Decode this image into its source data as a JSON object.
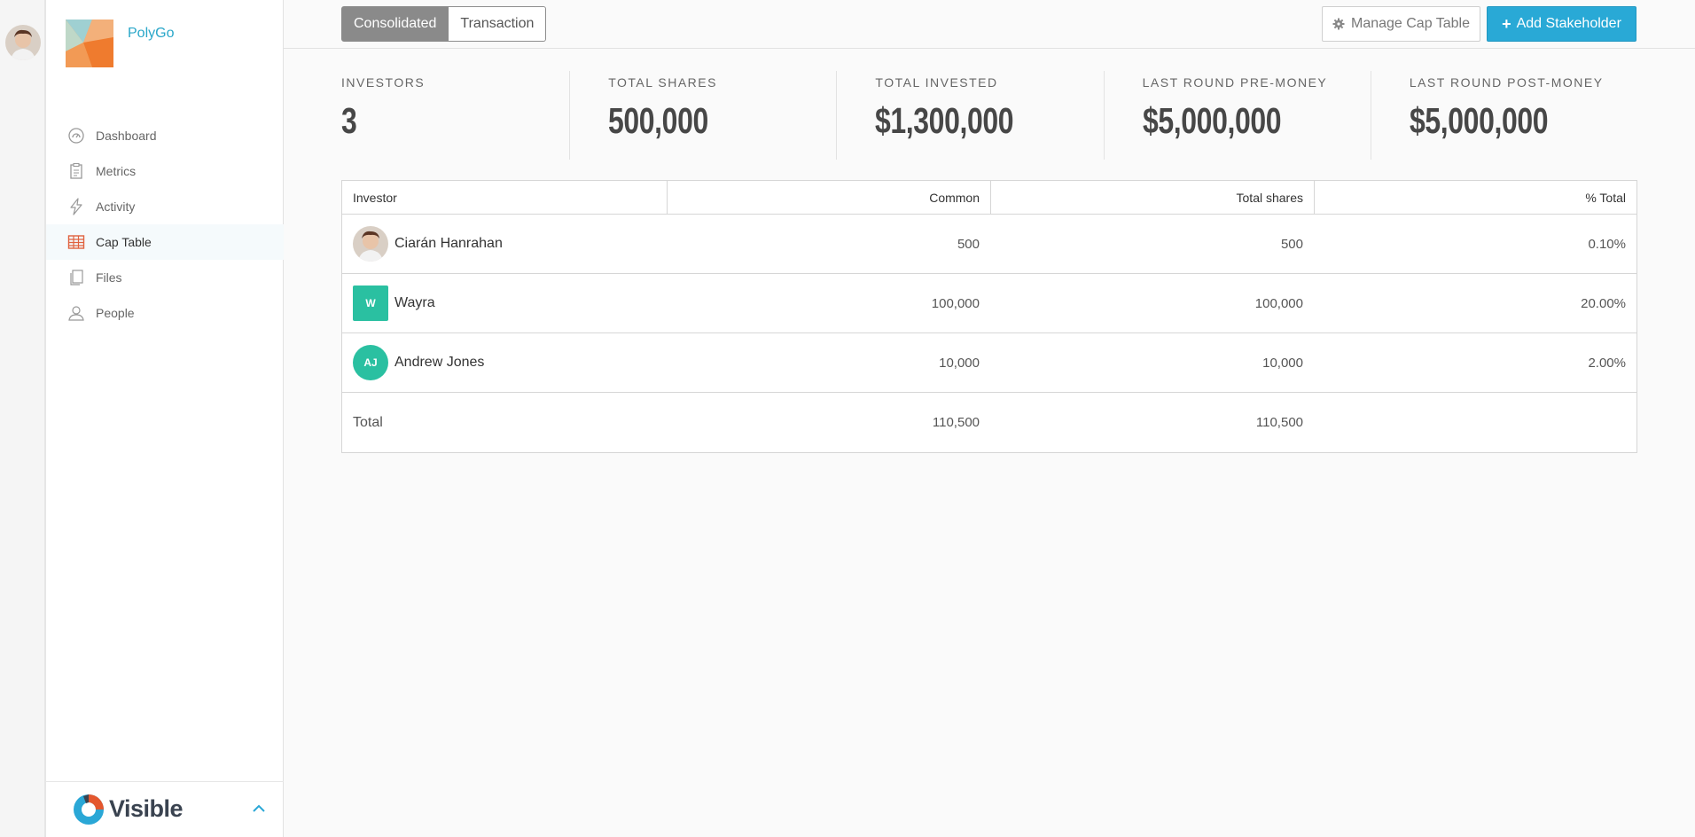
{
  "company": {
    "name": "PolyGo"
  },
  "nav": {
    "items": [
      {
        "label": "Dashboard",
        "icon": "dashboard-icon"
      },
      {
        "label": "Metrics",
        "icon": "clipboard-icon"
      },
      {
        "label": "Activity",
        "icon": "lightning-icon"
      },
      {
        "label": "Cap Table",
        "icon": "table-icon",
        "active": true
      },
      {
        "label": "Files",
        "icon": "files-icon"
      },
      {
        "label": "People",
        "icon": "people-icon"
      }
    ]
  },
  "brand": {
    "name": "Visible"
  },
  "toolbar": {
    "views": [
      "Consolidated",
      "Transaction"
    ],
    "selected_view": "Consolidated",
    "manage_label": "Manage Cap Table",
    "add_label": "Add Stakeholder"
  },
  "stats": [
    {
      "label": "INVESTORS",
      "value": "3"
    },
    {
      "label": "TOTAL SHARES",
      "value": "500,000"
    },
    {
      "label": "TOTAL INVESTED",
      "value": "$1,300,000"
    },
    {
      "label": "LAST ROUND PRE-MONEY",
      "value": "$5,000,000"
    },
    {
      "label": "LAST ROUND POST-MONEY",
      "value": "$5,000,000"
    }
  ],
  "table": {
    "columns": [
      "Investor",
      "Common",
      "Total shares",
      "% Total"
    ],
    "rows": [
      {
        "name": "Ciarán Hanrahan",
        "avatar": "photo",
        "common": "500",
        "total_shares": "500",
        "pct": "0.10%"
      },
      {
        "name": "Wayra",
        "avatar_initials": "W",
        "common": "100,000",
        "total_shares": "100,000",
        "pct": "20.00%"
      },
      {
        "name": "Andrew Jones",
        "avatar_initials": "AJ",
        "common": "10,000",
        "total_shares": "10,000",
        "pct": "2.00%"
      }
    ],
    "total": {
      "label": "Total",
      "common": "110,500",
      "total_shares": "110,500",
      "pct": ""
    }
  },
  "colors": {
    "accent": "#29a9d6",
    "avatar_green": "#2ac0a1",
    "company_name": "#2aa7c9"
  }
}
